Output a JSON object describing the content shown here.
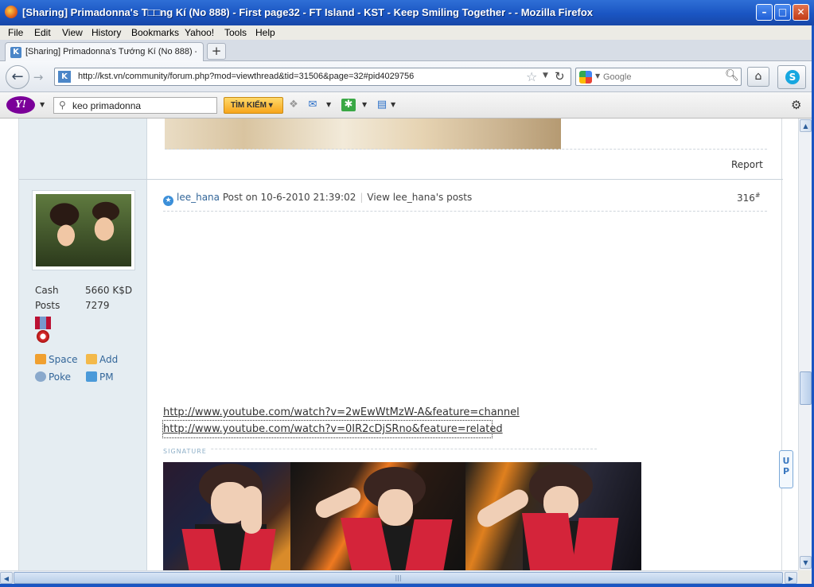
{
  "window": {
    "title": "[Sharing] Primadonna's T□□ng Kí (No 888) - First page32 - FT Island - KST - Keep Smiling Together - - Mozilla Firefox",
    "minimize": "–",
    "maximize": "□",
    "close": "✕"
  },
  "menu": {
    "file": "File",
    "edit": "Edit",
    "view": "View",
    "history": "History",
    "bookmarks": "Bookmarks",
    "yahoo": "Yahoo!",
    "tools": "Tools",
    "help": "Help"
  },
  "tab": {
    "label": "[Sharing] Primadonna's Tướng Kí (No 888) - ...",
    "new_tab": "+"
  },
  "nav": {
    "back": "←",
    "forward": "→",
    "url": "http://kst.vn/community/forum.php?mod=viewthread&tid=31506&page=32#pid4029756",
    "star": "☆",
    "reload": "↻",
    "search_placeholder": "Google",
    "home": "⌂",
    "skype": "S"
  },
  "yahoo_toolbar": {
    "logo": "Y!",
    "search_value": "keo primadonna",
    "search_button": "TÌM KIẾM ▾",
    "mail_icon": "✉",
    "addon_icon": "✱",
    "page_icon": "▤",
    "settings_icon": "⚙"
  },
  "previous_post": {
    "report": "Report"
  },
  "user": {
    "cash_label": "Cash",
    "cash_value": "5660 K$D",
    "posts_label": "Posts",
    "posts_value": "7279",
    "space": "Space",
    "add": "Add",
    "poke": "Poke",
    "pm": "PM"
  },
  "post": {
    "username": "lee_hana",
    "posted_on": "Post on 10-6-2010 21:39:02",
    "view_posts": "View lee_hana's posts",
    "number": "316",
    "number_sup": "#",
    "links": [
      "http://www.youtube.com/watch?v=2wEwWtMzW-A&feature=channel",
      "http://www.youtube.com/watch?v=0IR2cDjSRno&feature=related"
    ],
    "signature_label": "SIGNATURE"
  },
  "up_button": "U\nP",
  "colors": {
    "link": "#336699",
    "sidebar": "#e5edf2",
    "titlebar": "#1a55c2"
  }
}
